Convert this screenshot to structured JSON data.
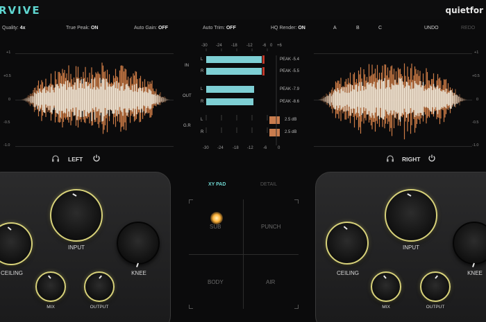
{
  "header": {
    "logo": "RVIVE",
    "brand": "quietfor"
  },
  "options": {
    "quality_label": "Quality:",
    "quality_value": "4x",
    "truepeak_label": "True Peak:",
    "truepeak_value": "ON",
    "autogain_label": "Auto Gain:",
    "autogain_value": "OFF",
    "autotrim_label": "Auto Trim:",
    "autotrim_value": "OFF",
    "hqrender_label": "HQ Render:",
    "hqrender_value": "ON",
    "presets": [
      "A",
      "B",
      "C"
    ],
    "undo": "UNDO",
    "redo": "REDO"
  },
  "waveform": {
    "scale": [
      "+1",
      "+0.5",
      "0",
      "-0.5",
      "-1.0"
    ],
    "left_label": "LEFT",
    "right_label": "RIGHT",
    "colors": {
      "body": "#f2e6d4",
      "peak": "#d9834a"
    }
  },
  "meters": {
    "scale_top": [
      "-30",
      "-24",
      "-18",
      "-12",
      "-6",
      "0",
      "+6"
    ],
    "scale_bottom": [
      "-30",
      "-24",
      "-18",
      "-12",
      "-6",
      "0"
    ],
    "in_label": "IN",
    "out_label": "OUT",
    "gr_label": "G.R",
    "L": "L",
    "R": "R",
    "in_peaks": [
      "PEAK -5.4",
      "PEAK -5.5"
    ],
    "out_peaks": [
      "PEAK -7.9",
      "PEAK -8.6"
    ],
    "gr_values": [
      "2.5 dB",
      "2.5 dB"
    ],
    "colors": {
      "level": "#7ecfd4",
      "gr": "#c87c4e",
      "clip": "#c0392b"
    }
  },
  "left_panel": {
    "input": "INPUT",
    "ceiling": "CEILING",
    "knee": "KNEE",
    "mix": "MIX",
    "output": "OUTPUT"
  },
  "right_panel": {
    "input": "INPUT",
    "ceiling": "CEILING",
    "knee": "KNEE",
    "mix": "MIX",
    "output": "OUTPUT"
  },
  "xypad": {
    "tab_xy": "XY PAD",
    "tab_detail": "DETAIL",
    "cells": [
      "SUB",
      "PUNCH",
      "BODY",
      "AIR"
    ]
  }
}
